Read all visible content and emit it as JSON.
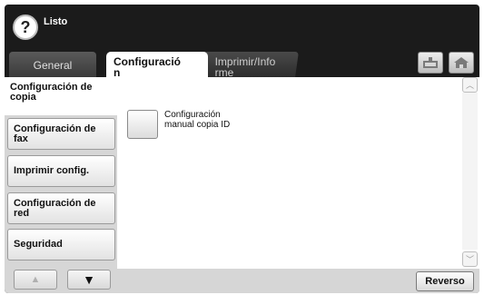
{
  "header": {
    "help_icon": "question-mark-icon",
    "help_glyph": "?",
    "status": "Listo",
    "actions": [
      {
        "icon": "tray-icon"
      },
      {
        "icon": "home-icon"
      }
    ]
  },
  "tabs": [
    {
      "label": "General",
      "active": false
    },
    {
      "label": "Configuració\nn",
      "active": true
    },
    {
      "label": "Imprimir/Info\nrme",
      "active": false
    }
  ],
  "sidebar": {
    "items": [
      {
        "label": "Configuración de\ncopia",
        "active": true
      },
      {
        "label": "Configuración de\nfax",
        "active": false
      },
      {
        "label": "Imprimir config.",
        "active": false
      },
      {
        "label": "Configuración de\nred",
        "active": false
      },
      {
        "label": "Seguridad",
        "active": false
      }
    ],
    "nav": {
      "up_glyph": "▲",
      "down_glyph": "▼"
    }
  },
  "main": {
    "options": [
      {
        "label": "Configuración\nmanual copia ID"
      }
    ]
  },
  "scroll": {
    "up_glyph": "︿",
    "down_glyph": "﹀"
  },
  "footer": {
    "reverse_label": "Reverso"
  },
  "colors": {
    "background_dark": "#1b1b1b",
    "content_gray": "#d6d6d6",
    "panel_white": "#ffffff"
  }
}
